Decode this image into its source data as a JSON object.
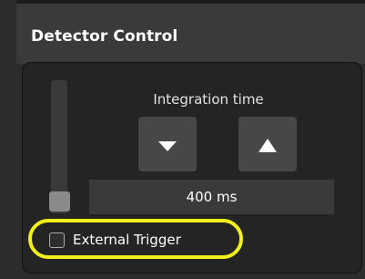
{
  "panel": {
    "title": "Detector Control"
  },
  "integration": {
    "label": "Integration time",
    "value": "400 ms",
    "decrease_icon": "triangle-down-icon",
    "increase_icon": "triangle-up-icon"
  },
  "slider": {
    "level": 0.0
  },
  "trigger": {
    "label": "External Trigger",
    "checked": false
  },
  "colors": {
    "highlight": "#f2ef1a",
    "panel_bg": "#242424",
    "header_bg": "#3a3a3a"
  }
}
